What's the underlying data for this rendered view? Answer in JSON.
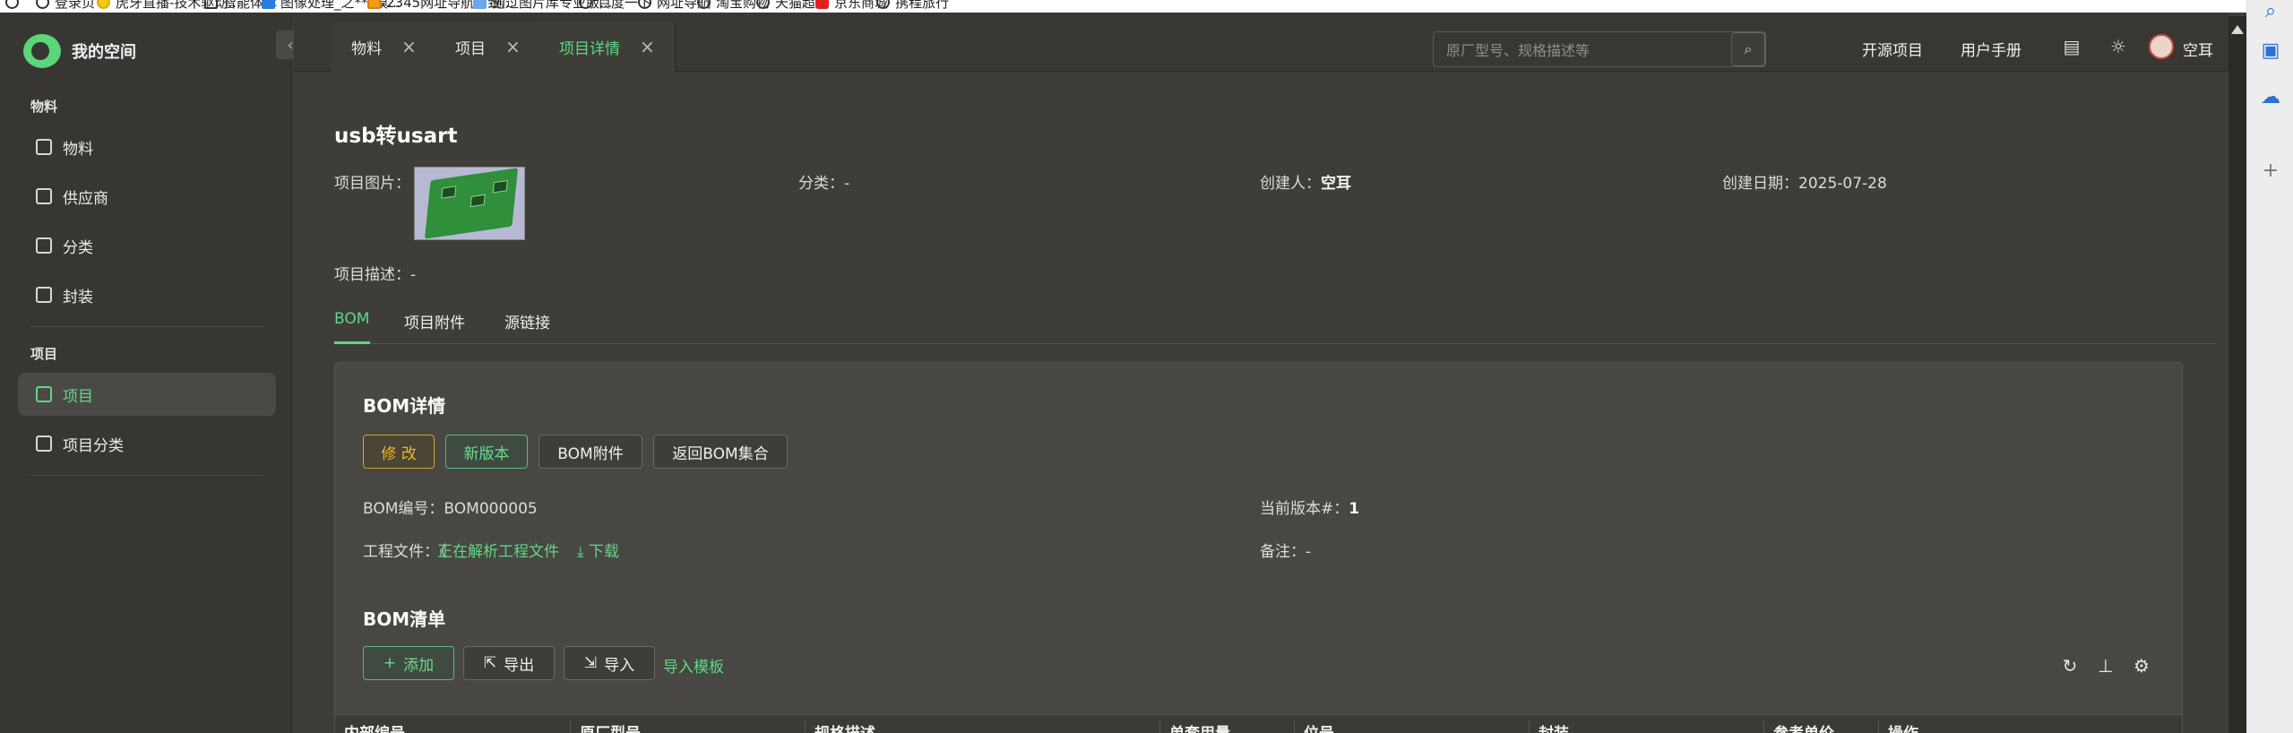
{
  "bookmarks": [
    "登录页",
    "虎牙直播-技术驱动...",
    "智能体库",
    "图像处理_之***模...",
    "2345网址导航 - 致...",
    "通过图片库专业版...",
    "百度一下",
    "网址导航",
    "淘宝购物",
    "天猫超市",
    "京东商城",
    "携程旅行"
  ],
  "sidebar": {
    "brand": "我的空间",
    "collapse_icon": "‹",
    "sections": [
      {
        "title": "物料",
        "items": [
          {
            "label": "物料"
          },
          {
            "label": "供应商"
          },
          {
            "label": "分类"
          },
          {
            "label": "封装"
          }
        ]
      },
      {
        "title": "项目",
        "items": [
          {
            "label": "项目"
          },
          {
            "label": "项目分类"
          }
        ]
      }
    ]
  },
  "tabs": [
    {
      "label": "物料",
      "close": "×"
    },
    {
      "label": "项目",
      "close": "×"
    },
    {
      "label": "项目详情",
      "close": "×"
    }
  ],
  "search": {
    "placeholder": "原厂型号、规格描述等",
    "icon": "⌕"
  },
  "header": {
    "open_source": "开源项目",
    "manual": "用户手册",
    "user": "空耳"
  },
  "project": {
    "title": "usb转usart",
    "image_label": "项目图片：",
    "category_label": "分类：",
    "category_value": "-",
    "creator_label": "创建人：",
    "creator_value": "空耳",
    "created_label": "创建日期：",
    "created_value": "2025-07-28",
    "desc_label": "项目描述：",
    "desc_value": "-"
  },
  "subtabs": [
    "BOM",
    "项目附件",
    "源链接"
  ],
  "bom": {
    "title": "BOM详情",
    "buttons": {
      "edit": "修 改",
      "new_version": "新版本",
      "attachments": "BOM附件",
      "back": "返回BOM集合"
    },
    "code_label": "BOM编号：",
    "code_value": "BOM000005",
    "version_label": "当前版本#：",
    "version_value": "1",
    "file_label": "工程文件：（",
    "file_status": "正在解析工程文件",
    "download": "下载",
    "note_label": "备注：",
    "note_value": "-",
    "list_title": "BOM清单",
    "actions": {
      "add": "添加",
      "export": "导出",
      "import": "导入",
      "template": "导入模板"
    },
    "columns": [
      "内部编号",
      "原厂型号",
      "规格描述",
      "单套用量",
      "位号",
      "封装",
      "参考单价",
      "操作"
    ]
  },
  "colors": {
    "accent": "#5ed885",
    "warn": "#e8b72e",
    "bg": "#3e3d38",
    "sidebar": "#373633"
  }
}
